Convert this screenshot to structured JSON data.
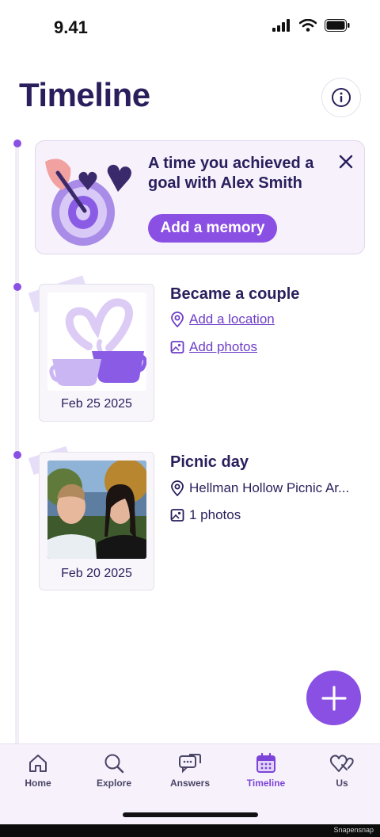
{
  "status_bar": {
    "time": "9.41"
  },
  "header": {
    "title": "Timeline"
  },
  "prompt_card": {
    "text": "A time you achieved a goal with Alex Smith",
    "button_label": "Add a memory"
  },
  "entries": [
    {
      "title": "Became a couple",
      "date": "Feb 25 2025",
      "location": "Add a location",
      "photos": "Add photos"
    },
    {
      "title": "Picnic day",
      "date": "Feb 20 2025",
      "location": "Hellman Hollow Picnic Ar...",
      "photos": "1 photos"
    }
  ],
  "tabs": [
    {
      "label": "Home",
      "icon": "home-icon"
    },
    {
      "label": "Explore",
      "icon": "search-icon"
    },
    {
      "label": "Answers",
      "icon": "chat-icon"
    },
    {
      "label": "Timeline",
      "icon": "calendar-icon",
      "active": true
    },
    {
      "label": "Us",
      "icon": "hearts-icon"
    }
  ],
  "watermark": "Snapensnap",
  "colors": {
    "accent": "#8a4fe3",
    "title": "#2a1f5c",
    "card_bg": "#f6f1fb"
  }
}
